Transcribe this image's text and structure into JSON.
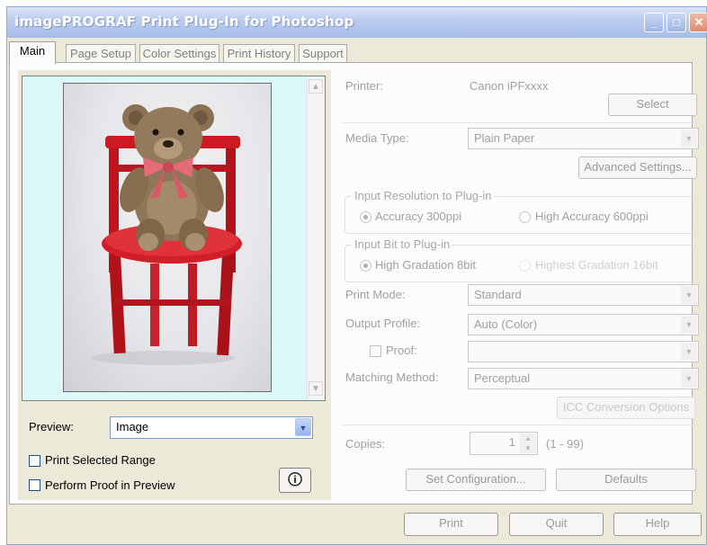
{
  "window": {
    "title": "imagePROGRAF Print Plug-In for Photoshop"
  },
  "tabs": [
    {
      "label": "Main"
    },
    {
      "label": "Page Setup"
    },
    {
      "label": "Color Settings"
    },
    {
      "label": "Print History"
    },
    {
      "label": "Support"
    }
  ],
  "preview": {
    "label": "Preview:",
    "value": "Image",
    "print_selected_range": "Print Selected Range",
    "perform_proof": "Perform Proof in Preview"
  },
  "printer": {
    "label": "Printer:",
    "name": "Canon iPFxxxx",
    "select_button": "Select"
  },
  "media_type": {
    "label": "Media Type:",
    "value": "Plain Paper",
    "advanced_button": "Advanced Settings..."
  },
  "input_resolution": {
    "group_title": "Input Resolution to Plug-in",
    "option1": "Accuracy 300ppi",
    "option2": "High Accuracy 600ppi",
    "selected": "option1"
  },
  "input_bit": {
    "group_title": "Input Bit to Plug-in",
    "option1": "High Gradation 8bit",
    "option2": "Highest Gradation 16bit",
    "selected": "option1"
  },
  "print_mode": {
    "label": "Print Mode:",
    "value": "Standard"
  },
  "output_profile": {
    "label": "Output Profile:",
    "value": "Auto (Color)"
  },
  "proof": {
    "label": "Proof:",
    "value": ""
  },
  "matching_method": {
    "label": "Matching Method:",
    "value": "Perceptual"
  },
  "icc_button": "ICC Conversion Options",
  "copies": {
    "label": "Copies:",
    "value": "1",
    "range": "(1 - 99)"
  },
  "set_configuration_button": "Set Configuration...",
  "defaults_button": "Defaults",
  "footer": {
    "print_button": "Print",
    "quit_button": "Quit",
    "help_button": "Help"
  },
  "colors": {
    "title_text": "#ffffff",
    "preview_bg": "#dcf8f8",
    "chair_red": "#c0141c",
    "disabled_text": "#a0a0a0"
  },
  "icons": [
    "minimize-icon",
    "maximize-icon",
    "close-icon",
    "info-icon",
    "chevron-down-icon",
    "spin-up-icon",
    "spin-down-icon"
  ]
}
